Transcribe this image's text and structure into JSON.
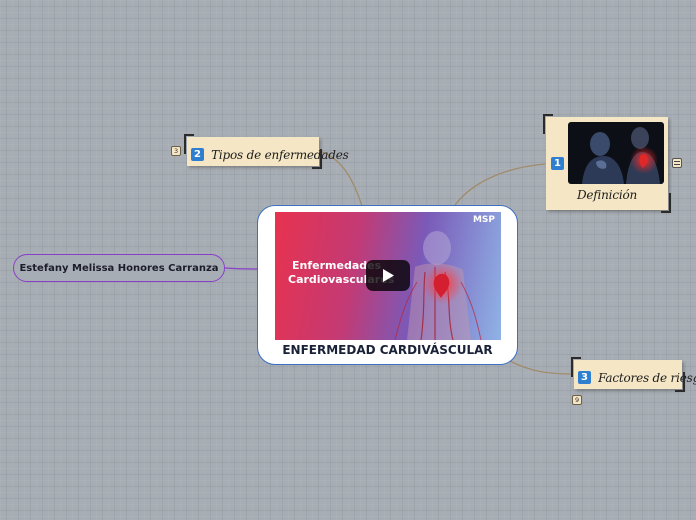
{
  "central": {
    "label": "ENFERMEDAD CARDIVÁSCULAR",
    "video_title_line1": "Enfermedades",
    "video_title_line2": "Cardiovasculares",
    "video_logo": "MSP"
  },
  "author": {
    "label": "Estefany Melissa Honores Carranza"
  },
  "topics": [
    {
      "number": "1",
      "label": "Definición"
    },
    {
      "number": "2",
      "label": "Tipos de enfermedades",
      "count": "3"
    },
    {
      "number": "3",
      "label": "Factores de riesgo",
      "count": "9"
    }
  ],
  "colors": {
    "accent_blue": "#2f7fd0",
    "central_border": "#3b6fc2",
    "author_border": "#8a3fc9",
    "topic_bg": "#f5e7c6",
    "connector": "#a08c6c",
    "canvas_bg": "#a7adb4"
  },
  "icons": [
    "play-icon",
    "note-icon"
  ]
}
